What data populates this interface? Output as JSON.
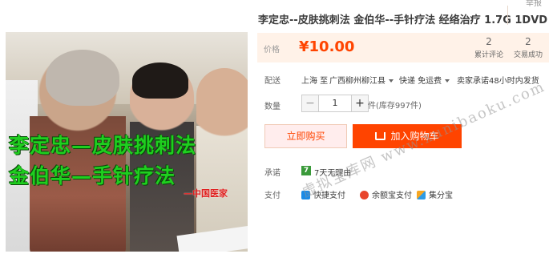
{
  "header": {
    "corner_link": "举报"
  },
  "product": {
    "title": "李定忠--皮肤挑刺法 金伯华--手针疗法 经络治疗 1.7G 1DVD",
    "image": {
      "caption_line1": "李定忠—皮肤挑刺法",
      "caption_line2": "金伯华—手针疗法",
      "caption_source": "—中国医家"
    }
  },
  "price": {
    "label": "价格",
    "value": "¥10.00"
  },
  "stats": [
    {
      "count": "2",
      "label": "累计评论"
    },
    {
      "count": "2",
      "label": "交易成功"
    }
  ],
  "shipping": {
    "label": "配送",
    "from": "上海 至",
    "to": "广西柳州柳江县",
    "method": "快递 免运费",
    "promise": "卖家承诺48小时内发货"
  },
  "quantity": {
    "label": "数量",
    "minus": "−",
    "value": "1",
    "plus": "+",
    "stock": "件(库存997件)"
  },
  "actions": {
    "buy_now": "立即购买",
    "add_to_cart": "加入购物车"
  },
  "promise": {
    "label": "承诺",
    "icon_text": "7",
    "text": "7天无理由"
  },
  "payment": {
    "label": "支付",
    "methods": [
      "快捷支付",
      "余额宝支付",
      "集分宝"
    ]
  },
  "watermark": "虚拟宝库网 www.xunibaoku.com",
  "colors": {
    "accent": "#ff4400",
    "price_bg": "#fff2e8",
    "promise_icon": "#3a9a3a"
  }
}
